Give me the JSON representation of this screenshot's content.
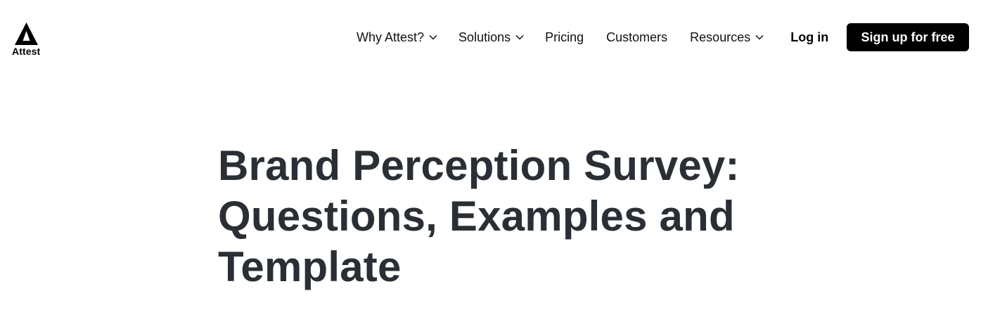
{
  "header": {
    "logo_text": "Attest",
    "nav": {
      "why_attest": "Why Attest?",
      "solutions": "Solutions",
      "pricing": "Pricing",
      "customers": "Customers",
      "resources": "Resources"
    },
    "login_label": "Log in",
    "signup_label": "Sign up for free"
  },
  "article": {
    "title": "Brand Perception Survey: Questions, Examples and Template"
  },
  "colors": {
    "primary_button_bg": "#000000",
    "primary_button_text": "#ffffff",
    "title_text": "#2a2f35"
  },
  "icons": {
    "logo": "attest-triangle-logo",
    "dropdown": "chevron-down-icon"
  }
}
